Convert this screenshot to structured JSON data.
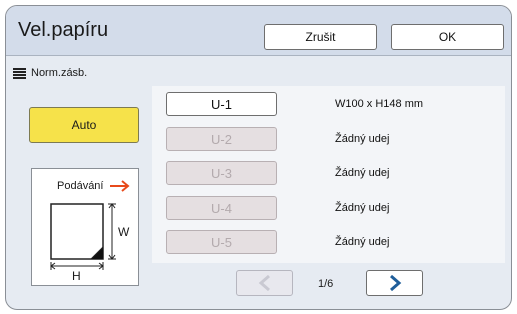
{
  "header": {
    "title": "Vel.papíru",
    "cancel_label": "Zrušit",
    "ok_label": "OK"
  },
  "mode": {
    "icon": "lines-icon",
    "label": "Norm.zásb."
  },
  "auto_button": {
    "label": "Auto",
    "color": "#f6e24a"
  },
  "illustration": {
    "label": "Podávání",
    "height_label": "W",
    "width_label": "H",
    "arrow_color": "#e84a1b"
  },
  "sizes": [
    {
      "label": "U-1",
      "description": "W100 x H148 mm",
      "enabled": true
    },
    {
      "label": "U-2",
      "description": "Žádný udej",
      "enabled": false
    },
    {
      "label": "U-3",
      "description": "Žádný udej",
      "enabled": false
    },
    {
      "label": "U-4",
      "description": "Žádný udej",
      "enabled": false
    },
    {
      "label": "U-5",
      "description": "Žádný udej",
      "enabled": false
    }
  ],
  "pager": {
    "indicator": "1/6",
    "prev_icon": "chevron-left-icon",
    "next_icon": "chevron-right-icon",
    "prev_enabled": false,
    "next_enabled": true,
    "chevron_color": "#1f5e9a"
  }
}
